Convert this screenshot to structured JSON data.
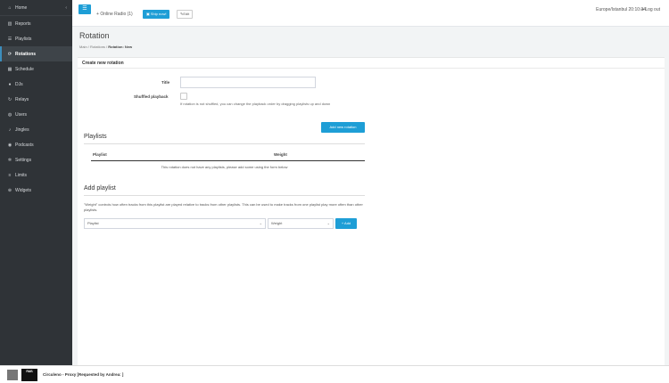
{
  "sidebar": {
    "items": [
      {
        "label": "Home",
        "icon": "home-icon",
        "glyph": "⌂",
        "active": false
      },
      {
        "label": "Reports",
        "icon": "chart-icon",
        "glyph": "▥",
        "active": false
      },
      {
        "label": "Playlists",
        "icon": "list-icon",
        "glyph": "☰",
        "active": false
      },
      {
        "label": "Rotations",
        "icon": "rotate-icon",
        "glyph": "⟳",
        "active": true
      },
      {
        "label": "Schedule",
        "icon": "calendar-icon",
        "glyph": "▦",
        "active": false
      },
      {
        "label": "DJs",
        "icon": "user-icon",
        "glyph": "●",
        "active": false
      },
      {
        "label": "Relays",
        "icon": "relay-icon",
        "glyph": "↻",
        "active": false
      },
      {
        "label": "Users",
        "icon": "users-icon",
        "glyph": "◍",
        "active": false
      },
      {
        "label": "Jingles",
        "icon": "bell-icon",
        "glyph": "♪",
        "active": false
      },
      {
        "label": "Podcasts",
        "icon": "podcast-icon",
        "glyph": "◉",
        "active": false
      },
      {
        "label": "Settings",
        "icon": "gear-icon",
        "glyph": "✲",
        "active": false
      },
      {
        "label": "Limits",
        "icon": "limits-icon",
        "glyph": "≡",
        "active": false
      },
      {
        "label": "Widgets",
        "icon": "widget-icon",
        "glyph": "⊕",
        "active": false
      }
    ],
    "home_chevron": "‹"
  },
  "topbar": {
    "menu_glyph": "☰",
    "radio_label": "Online Radio (1)",
    "radio_prefix": "+",
    "ship_label": "Ship now!",
    "edit_label": "Edit",
    "user": "Europe/Istanbul 20:10:34",
    "logout": "Log out"
  },
  "page": {
    "title": "Rotation",
    "crumbs": [
      "Main",
      "Rotations"
    ],
    "crumb_current": "Rotation: New"
  },
  "form": {
    "panel_title": "Create new rotation",
    "title_label": "Title",
    "title_value": "",
    "shuffle_label": "Shuffled playback",
    "shuffle_help": "If rotation is not shuffled, you can change the playback order by dragging playlists up and down",
    "submit_label": "Add new rotation"
  },
  "playlists": {
    "heading": "Playlists",
    "col_playlist": "Playlist",
    "col_weight": "Weight",
    "empty_text": "This rotation does not have any playlists, please add some using the form below"
  },
  "add_playlist": {
    "heading": "Add playlist",
    "hint": "\"Weight\" controls how often tracks from this playlist are played relative to tracks from other playlists. This can be used to make tracks from one playlist play more often than other playlists.",
    "playlist_select": "Playlist",
    "weight_select": "Weight",
    "add_label": "+ Add"
  },
  "player": {
    "thumb_text": "ЯАБ",
    "now_playing": "Circuleno - Proxy [Requested by Andrea: ]"
  }
}
